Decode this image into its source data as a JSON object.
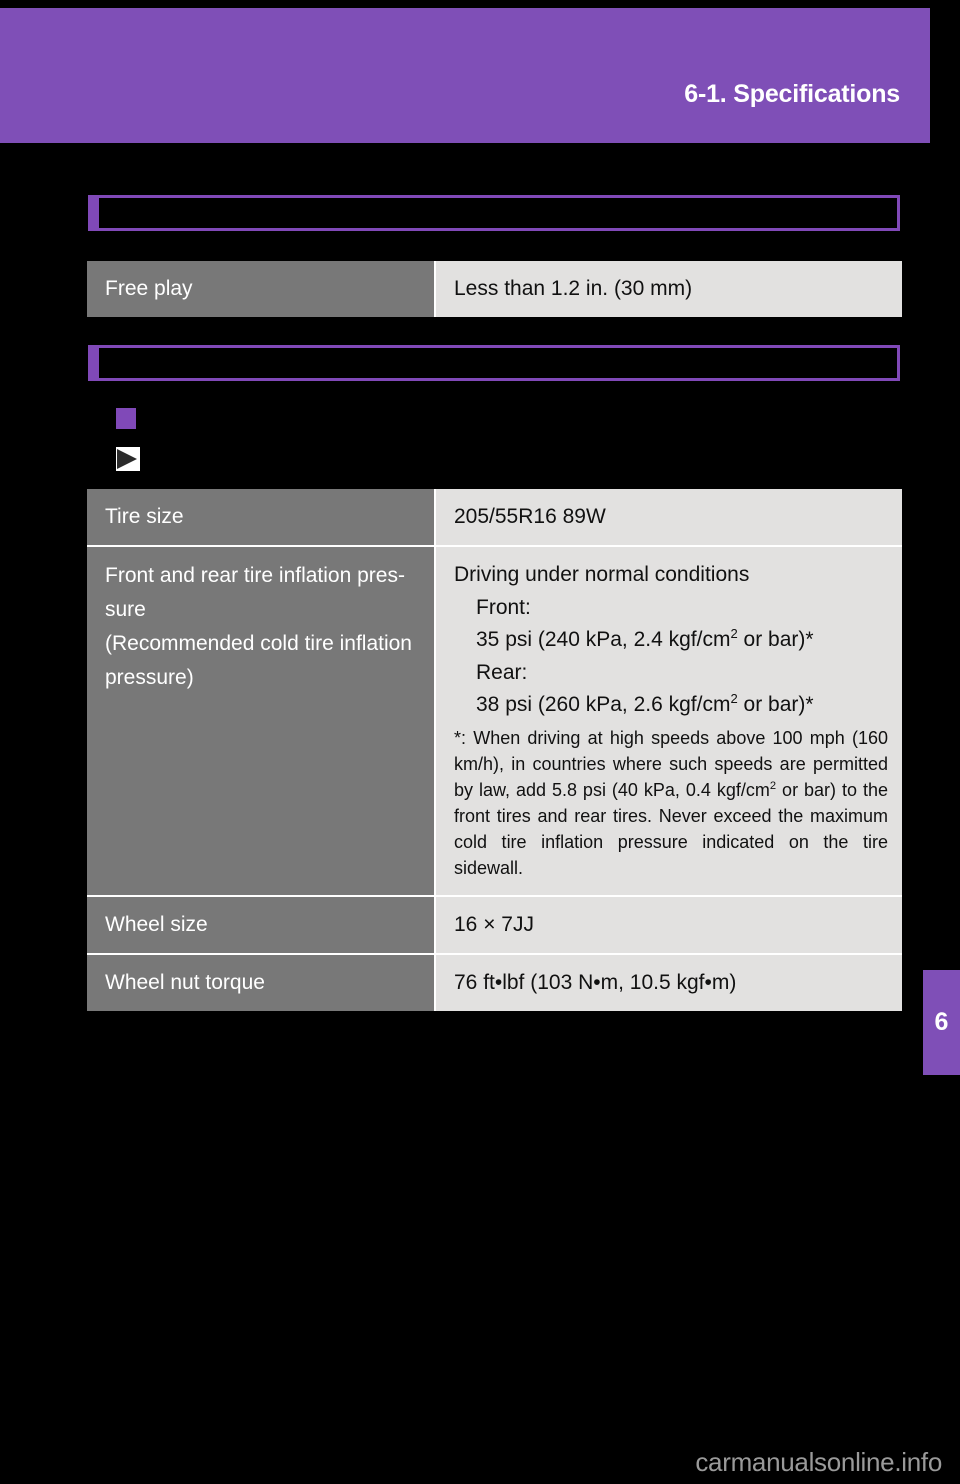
{
  "header": {
    "title": "6-1. Specifications"
  },
  "sections": [
    {
      "heading": "",
      "table": {
        "rows": [
          {
            "label": "Free play",
            "value": "Less than 1.2 in. (30 mm)"
          }
        ]
      }
    },
    {
      "heading": "",
      "bullet_label": "",
      "flag_label": ""
    }
  ],
  "tire_table": {
    "tire_size": {
      "label": "Tire size",
      "value": "205/55R16 89W"
    },
    "inflation": {
      "label_line1": "Front and rear tire inflation pres-",
      "label_line2": "sure",
      "label_line3": "(Recommended cold tire inflation",
      "label_line4": "pressure)",
      "condition": "Driving under normal conditions",
      "front_label": "Front:",
      "front_value_pre": "35 psi (240 kPa, 2.4 kgf/cm",
      "front_value_sup": "2",
      "front_value_post": " or bar)*",
      "rear_label": "Rear:",
      "rear_value_pre": "38 psi (260 kPa, 2.6 kgf/cm",
      "rear_value_sup": "2",
      "rear_value_post": " or bar)*",
      "note_part1": "*: When driving at high speeds above 100 mph (160 km/h), in countries where such speeds are permitted by law, add 5.8 psi (40 kPa, 0.4 kgf/cm",
      "note_sup": "2",
      "note_part2": " or bar) to the front tires and rear tires.",
      "note_part3": "Never exceed the maximum cold tire inflation pressure indicated on the tire sidewall."
    },
    "wheel_size": {
      "label": "Wheel size",
      "value": "16 × 7JJ"
    },
    "wheel_nut_torque": {
      "label": "Wheel nut torque",
      "value": "76 ft•lbf (103 N•m, 10.5 kgf•m)"
    }
  },
  "chapter_tab": {
    "number": "6"
  },
  "watermark": {
    "text": "carmanualsonline.info"
  },
  "colors": {
    "accent_purple": "#7F4FB7",
    "border_purple": "#8049B8",
    "label_gray": "#787878",
    "value_gray": "#E2E1E0",
    "page_black": "#000000"
  }
}
